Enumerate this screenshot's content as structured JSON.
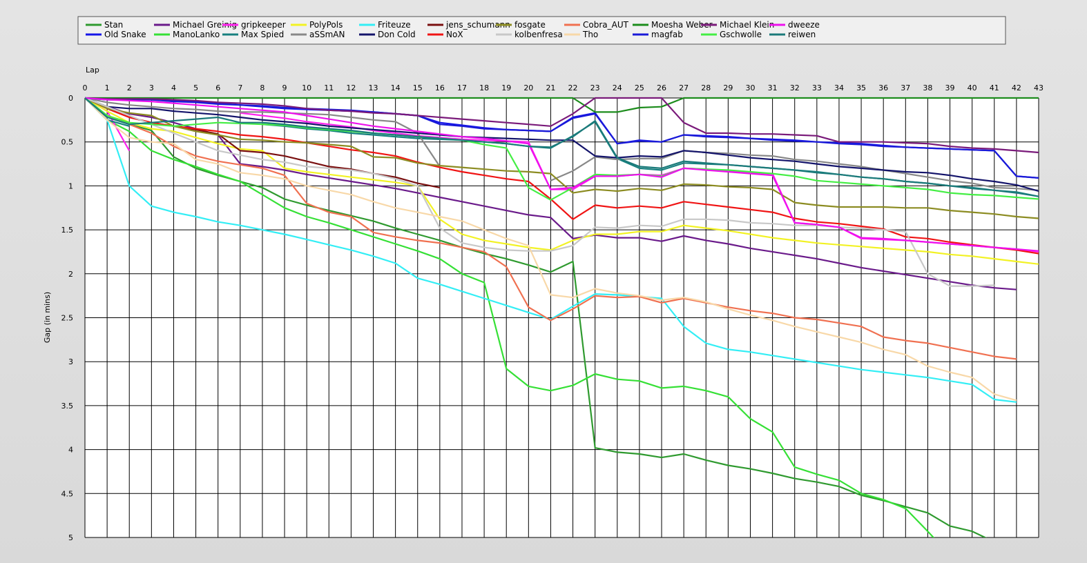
{
  "chart_data": {
    "type": "line",
    "title": "",
    "xlabel": "Lap",
    "ylabel": "Gap (in mins)",
    "xlim": [
      0,
      43
    ],
    "ylim": [
      0,
      5
    ],
    "y_inverted": true,
    "grid": true,
    "legend_placement": "top",
    "x": [
      0,
      1,
      2,
      3,
      4,
      5,
      6,
      7,
      8,
      9,
      10,
      11,
      12,
      13,
      14,
      15,
      16,
      17,
      18,
      19,
      20,
      21,
      22,
      23,
      24,
      25,
      26,
      27,
      28,
      29,
      30,
      31,
      32,
      33,
      34,
      35,
      36,
      37,
      38,
      39,
      40,
      41,
      42,
      43
    ],
    "x_ticks": [
      "0",
      "1",
      "2",
      "3",
      "4",
      "5",
      "6",
      "7",
      "8",
      "9",
      "10",
      "11",
      "12",
      "13",
      "14",
      "15",
      "16",
      "17",
      "18",
      "19",
      "20",
      "21",
      "22",
      "23",
      "24",
      "25",
      "26",
      "27",
      "28",
      "29",
      "30",
      "31",
      "32",
      "33",
      "34",
      "35",
      "36",
      "37",
      "38",
      "39",
      "40",
      "41",
      "42",
      "43"
    ],
    "y_ticks": [
      "0",
      "0.5",
      "1",
      "1.5",
      "2",
      "2.5",
      "3",
      "3.5",
      "4",
      "4.5",
      "5"
    ],
    "series": [
      {
        "name": "Stan",
        "color": "#2f9a2f",
        "values": [
          0,
          0.2,
          0.3,
          0.37,
          0.67,
          0.8,
          0.88,
          0.95,
          1.02,
          1.15,
          1.22,
          1.28,
          1.34,
          1.4,
          1.48,
          1.55,
          1.62,
          1.7,
          1.77,
          1.83,
          1.9,
          1.98,
          1.86,
          3.98,
          4.03,
          4.05,
          4.09,
          4.05,
          4.12,
          4.18,
          4.22,
          4.27,
          4.33,
          4.37,
          4.42,
          4.52,
          4.58,
          4.65,
          4.72,
          4.87,
          4.93,
          5.05
        ]
      },
      {
        "name": "Old Snake",
        "color": "#1515e8",
        "values": [
          0,
          0.02,
          0.02,
          0.02,
          0.03,
          0.04,
          0.06,
          0.08,
          0.1,
          0.12,
          0.13,
          0.14,
          0.15,
          0.16,
          0.18,
          0.2,
          0.28,
          0.31,
          0.34,
          0.36,
          0.37,
          0.38,
          0.22,
          0.17,
          0.52,
          0.48,
          0.5,
          0.42,
          0.43,
          0.44,
          0.46,
          0.47,
          0.48,
          0.5,
          0.51,
          0.52,
          0.54,
          0.56,
          0.57,
          0.58,
          0.59,
          0.6,
          0.89,
          0.91
        ]
      },
      {
        "name": "Michael Greinig",
        "color": "#6a1a8a",
        "values": [
          0,
          0.1,
          0.18,
          0.22,
          0.28,
          0.35,
          0.42,
          0.75,
          0.78,
          0.82,
          0.87,
          0.91,
          0.95,
          0.99,
          1.03,
          1.08,
          1.13,
          1.18,
          1.23,
          1.28,
          1.33,
          1.36,
          1.6,
          1.56,
          1.59,
          1.59,
          1.63,
          1.57,
          1.62,
          1.66,
          1.71,
          1.75,
          1.79,
          1.83,
          1.88,
          1.93,
          1.97,
          2.01,
          2.05,
          2.09,
          2.13,
          2.16,
          2.18
        ]
      },
      {
        "name": "ManoLanko",
        "color": "#35e035",
        "values": [
          0,
          0.25,
          0.38,
          0.6,
          0.7,
          0.78,
          0.87,
          0.95,
          1.1,
          1.25,
          1.35,
          1.42,
          1.5,
          1.58,
          1.66,
          1.74,
          1.83,
          2.0,
          2.1,
          3.08,
          3.28,
          3.33,
          3.27,
          3.14,
          3.2,
          3.22,
          3.3,
          3.28,
          3.33,
          3.4,
          3.65,
          3.8,
          4.2,
          4.28,
          4.35,
          4.5,
          4.57,
          4.67,
          4.93,
          5.2
        ]
      },
      {
        "name": "gripkeeper",
        "color": "#ff22ee",
        "values": [
          0,
          0.15,
          0.6,
          null,
          null,
          null,
          null,
          0.17,
          0.2,
          0.23,
          0.27,
          0.3,
          0.33,
          0.37,
          0.4,
          0.43,
          0.45,
          0.47,
          0.48,
          0.49,
          0.5,
          1.04,
          1.04,
          0.89,
          0.89,
          0.87,
          0.88,
          0.8,
          0.81,
          0.83,
          0.85,
          0.86,
          1.42,
          1.44,
          1.47,
          1.6,
          1.61,
          1.62,
          1.64,
          1.66,
          1.68,
          1.7,
          1.72,
          1.75
        ]
      },
      {
        "name": "Max Spied",
        "color": "#17807f",
        "values": [
          0,
          0.25,
          0.32,
          null,
          null,
          null,
          null,
          null,
          0.3,
          0.32,
          0.35,
          0.37,
          0.4,
          0.42,
          0.44,
          0.46,
          0.47,
          0.48,
          0.5,
          0.52,
          0.55,
          0.57,
          0.43,
          0.27,
          0.69,
          0.8,
          0.82,
          0.74,
          0.75,
          0.76,
          0.78,
          0.8,
          0.82,
          0.84,
          0.87,
          0.9,
          0.92,
          0.95,
          0.97,
          1.0,
          1.02,
          1.05,
          1.07,
          1.12
        ]
      },
      {
        "name": "PolyPols",
        "color": "#f2f224",
        "values": [
          0,
          0.15,
          0.28,
          0.35,
          0.38,
          0.45,
          0.52,
          0.58,
          0.6,
          0.8,
          0.84,
          0.87,
          0.9,
          0.93,
          0.96,
          1.0,
          1.38,
          1.55,
          1.62,
          1.66,
          1.7,
          1.73,
          1.62,
          1.55,
          1.55,
          1.52,
          1.52,
          1.45,
          1.48,
          1.51,
          1.55,
          1.59,
          1.62,
          1.65,
          1.67,
          1.69,
          1.71,
          1.73,
          1.75,
          1.78,
          1.8,
          1.83,
          1.86,
          1.89
        ]
      },
      {
        "name": "aSSmAN",
        "color": "#888888",
        "values": [
          0,
          0.05,
          0.08,
          0.1,
          0.12,
          0.13,
          0.15,
          0.16,
          0.16,
          0.17,
          0.18,
          0.19,
          0.22,
          0.25,
          0.27,
          0.4,
          0.78,
          null,
          null,
          null,
          null,
          0.94,
          0.83,
          0.67,
          0.7,
          0.69,
          0.69,
          0.6,
          0.62,
          0.63,
          0.65,
          0.66,
          0.7,
          0.72,
          0.75,
          0.78,
          0.82,
          0.86,
          0.9,
          0.94,
          0.97,
          1.02,
          1.03,
          1.05
        ]
      },
      {
        "name": "Friteuze",
        "color": "#33eef5",
        "values": [
          0,
          0.25,
          1.0,
          1.23,
          1.3,
          1.35,
          1.41,
          1.45,
          1.5,
          1.55,
          1.61,
          1.67,
          1.73,
          1.8,
          1.88,
          2.05,
          2.12,
          2.2,
          2.28,
          2.36,
          2.44,
          2.52,
          2.37,
          2.23,
          2.24,
          2.26,
          2.28,
          2.6,
          2.79,
          2.86,
          2.89,
          2.93,
          2.97,
          3.01,
          3.05,
          3.09,
          3.12,
          3.15,
          3.18,
          3.22,
          3.26,
          3.43,
          3.46
        ]
      },
      {
        "name": "Don Cold",
        "color": "#14146b",
        "values": [
          0,
          0.1,
          0.12,
          0.12,
          0.15,
          0.17,
          0.19,
          0.22,
          0.25,
          0.27,
          0.29,
          0.32,
          0.34,
          0.36,
          0.38,
          0.4,
          0.42,
          0.44,
          0.45,
          0.46,
          0.47,
          0.48,
          0.48,
          0.66,
          0.68,
          0.66,
          0.67,
          0.6,
          0.62,
          0.65,
          0.68,
          0.7,
          0.72,
          0.75,
          0.78,
          0.8,
          0.82,
          0.84,
          0.85,
          0.88,
          0.92,
          0.95,
          0.99,
          1.06
        ]
      },
      {
        "name": "jens_schumann",
        "color": "#7a1010",
        "values": [
          0,
          0.12,
          0.22,
          0.28,
          0.32,
          0.36,
          0.41,
          0.6,
          0.62,
          0.66,
          0.72,
          0.78,
          0.81,
          0.86,
          0.9,
          0.97,
          1.02
        ]
      },
      {
        "name": "NoX",
        "color": "#f01414",
        "values": [
          0,
          0.12,
          0.22,
          0.28,
          0.32,
          0.35,
          0.38,
          0.42,
          0.44,
          0.47,
          0.51,
          0.55,
          0.59,
          0.62,
          0.66,
          0.73,
          0.79,
          0.84,
          0.88,
          0.92,
          0.95,
          1.15,
          1.38,
          1.22,
          1.25,
          1.23,
          1.25,
          1.18,
          1.21,
          1.24,
          1.27,
          1.3,
          1.37,
          1.41,
          1.43,
          1.46,
          1.49,
          1.58,
          1.6,
          1.64,
          1.67,
          1.7,
          1.73,
          1.77
        ]
      },
      {
        "name": "fosgate",
        "color": "#8c8c22",
        "values": [
          0,
          0.12,
          0.17,
          0.2,
          0.32,
          0.38,
          0.42,
          0.47,
          0.48,
          0.5,
          0.51,
          0.53,
          0.55,
          0.67,
          0.68,
          0.74,
          0.77,
          0.79,
          0.81,
          0.83,
          0.84,
          0.86,
          1.08,
          1.04,
          1.06,
          1.03,
          1.05,
          0.98,
          0.99,
          1.01,
          1.02,
          1.04,
          1.19,
          1.22,
          1.24,
          1.24,
          1.24,
          1.25,
          1.25,
          1.28,
          1.3,
          1.32,
          1.35,
          1.37
        ]
      },
      {
        "name": "kolbenfresa",
        "color": "#c8c8c8",
        "values": [
          0,
          0.1,
          0.2,
          0.3,
          0.4,
          0.5,
          0.6,
          0.65,
          0.7,
          0.73,
          0.78,
          0.8,
          0.82,
          0.86,
          0.92,
          1.0,
          1.48,
          1.65,
          1.7,
          1.73,
          1.74,
          1.74,
          1.68,
          1.47,
          1.48,
          1.45,
          1.46,
          1.38,
          1.38,
          1.39,
          1.42,
          1.43,
          1.45,
          1.45,
          1.47,
          1.48,
          1.5,
          1.52,
          2.0,
          2.14,
          2.14,
          2.13
        ]
      },
      {
        "name": "Cobra_AUT",
        "color": "#f07050",
        "values": [
          0,
          0.2,
          0.3,
          0.4,
          0.55,
          0.66,
          0.72,
          0.76,
          0.8,
          0.88,
          1.2,
          1.3,
          1.35,
          1.53,
          1.58,
          1.62,
          1.65,
          1.7,
          1.75,
          1.92,
          2.38,
          2.53,
          2.4,
          2.25,
          2.27,
          2.26,
          2.33,
          2.28,
          2.33,
          2.38,
          2.42,
          2.45,
          2.5,
          2.52,
          2.56,
          2.6,
          2.72,
          2.76,
          2.79,
          2.84,
          2.89,
          2.94,
          2.97
        ]
      },
      {
        "name": "Tho",
        "color": "#f8d8a8",
        "values": [
          0,
          0.25,
          0.45,
          0.5,
          0.52,
          0.7,
          0.75,
          0.85,
          0.88,
          0.92,
          1.0,
          1.05,
          1.1,
          1.18,
          1.25,
          1.3,
          1.35,
          1.4,
          1.5,
          1.6,
          1.68,
          2.24,
          2.27,
          2.17,
          2.22,
          2.25,
          2.3,
          2.27,
          2.32,
          2.4,
          2.47,
          2.53,
          2.6,
          2.66,
          2.72,
          2.78,
          2.86,
          2.92,
          3.05,
          3.12,
          3.18,
          3.37,
          3.44
        ]
      },
      {
        "name": "Moesha Weber",
        "color": "#1c8c1c",
        "values": [
          0,
          0,
          0,
          0,
          0,
          0,
          0,
          0,
          0,
          0,
          0,
          0,
          0,
          0,
          0,
          0,
          0,
          0,
          0,
          0,
          0,
          0,
          0,
          0.16,
          0.16,
          0.11,
          0.1,
          0,
          0,
          0,
          0,
          0,
          0,
          0,
          0,
          0,
          0,
          0,
          0,
          0,
          0,
          0,
          0,
          0
        ]
      },
      {
        "name": "magfab",
        "color": "#1a1ad8",
        "values": [
          0,
          0.02,
          0.02,
          0.02,
          0.04,
          0.05,
          0.07,
          0.08,
          0.09,
          0.11,
          0.12,
          0.13,
          0.14,
          0.16,
          0.18,
          0.2,
          0.3,
          0.32,
          0.35,
          0.36,
          0.37,
          0.38,
          0.23,
          0.18,
          0.52,
          0.49,
          0.5,
          0.42,
          0.44,
          0.45,
          0.46,
          0.48,
          0.49,
          0.5,
          0.52,
          0.53,
          0.55,
          0.56,
          0.57,
          0.58,
          0.59,
          0.6,
          0.89,
          0.91
        ]
      },
      {
        "name": "Michael Klein",
        "color": "#7a1a7a",
        "values": [
          0,
          0.01,
          0.01,
          0.01,
          0.02,
          0.03,
          0.05,
          0.06,
          0.07,
          0.09,
          0.12,
          0.14,
          0.15,
          0.17,
          0.18,
          0.2,
          0.22,
          0.24,
          0.26,
          0.28,
          0.3,
          0.32,
          0.18,
          0,
          0,
          0,
          0,
          0.28,
          0.4,
          0.4,
          0.41,
          0.41,
          0.42,
          0.43,
          0.5,
          0.5,
          0.5,
          0.51,
          0.52,
          0.55,
          0.57,
          0.58,
          0.6,
          0.62
        ]
      },
      {
        "name": "Gschwolle",
        "color": "#44ee44",
        "values": [
          0,
          0.2,
          0.28,
          0.3,
          0.32,
          0.3,
          0.28,
          0.29,
          0.3,
          0.31,
          0.34,
          0.36,
          0.38,
          0.4,
          0.42,
          0.44,
          0.46,
          0.48,
          0.53,
          0.57,
          1.02,
          1.16,
          1.02,
          0.87,
          0.88,
          0.87,
          0.89,
          0.8,
          0.81,
          0.82,
          0.84,
          0.86,
          0.89,
          0.94,
          0.96,
          0.98,
          1.0,
          1.02,
          1.04,
          1.08,
          1.1,
          1.11,
          1.13,
          1.15
        ]
      },
      {
        "name": "dweeze",
        "color": "#ee11ee",
        "values": [
          0,
          0.02,
          0.03,
          0.04,
          0.06,
          0.08,
          0.1,
          0.12,
          0.14,
          0.16,
          0.2,
          0.24,
          0.28,
          0.32,
          0.35,
          0.38,
          0.41,
          0.44,
          0.46,
          0.49,
          0.52,
          1.04,
          1.02,
          0.89,
          0.89,
          0.87,
          0.9,
          0.8,
          0.82,
          0.84,
          0.86,
          0.88,
          1.42,
          1.44,
          1.47,
          1.59,
          1.6,
          1.62,
          1.64,
          1.66,
          1.68,
          1.7,
          1.72,
          1.74
        ]
      },
      {
        "name": "reiwen",
        "color": "#1b7a7a",
        "values": [
          0,
          0.22,
          0.3,
          0.28,
          0.26,
          0.24,
          0.22,
          0.28,
          0.28,
          0.3,
          0.33,
          0.35,
          0.37,
          0.4,
          0.42,
          0.44,
          0.46,
          0.48,
          0.5,
          0.52,
          0.55,
          0.56,
          0.44,
          0.26,
          0.68,
          0.78,
          0.8,
          0.72,
          0.74,
          0.76,
          0.78,
          0.8,
          0.82,
          0.85,
          0.87,
          0.9,
          0.92,
          0.95,
          0.97,
          1.0,
          1.03,
          1.05,
          1.08,
          1.12
        ]
      }
    ]
  }
}
